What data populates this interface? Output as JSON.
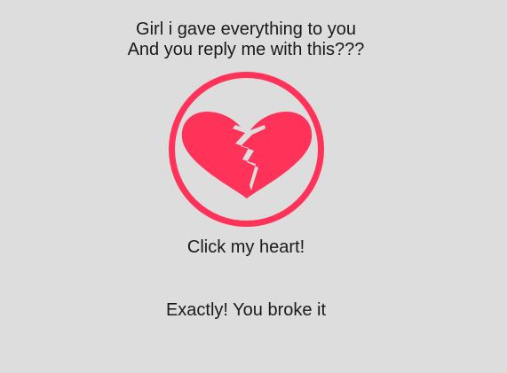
{
  "header": {
    "line1": "Girl i gave everything to you",
    "line2": "And you reply me with this???"
  },
  "heart": {
    "icon": "broken-heart-icon",
    "color": "#ff325a",
    "background": "#dddddd"
  },
  "prompt": {
    "label": "Click my heart!"
  },
  "result": {
    "message": "Exactly! You broke it"
  }
}
